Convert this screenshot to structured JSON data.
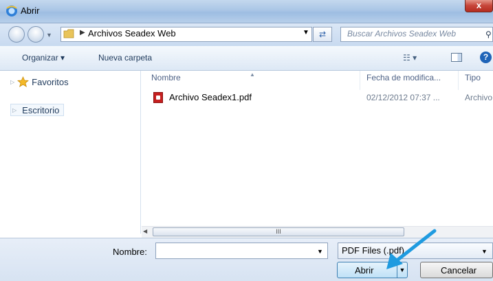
{
  "window": {
    "title": "Abrir",
    "close_label": "x"
  },
  "address": {
    "path": "Archivos Seadex Web",
    "search_placeholder": "Buscar Archivos Seadex Web",
    "refresh_glyph": "⇄"
  },
  "toolbar": {
    "organize_label": "Organizar ▾",
    "new_folder_label": "Nueva carpeta",
    "views_label": "☷ ▾",
    "help_label": "?"
  },
  "sidebar": {
    "items": [
      {
        "label": "Favoritos",
        "icon": "star-icon"
      },
      {
        "label": "Escritorio",
        "icon": "desktop-icon"
      }
    ]
  },
  "file_list": {
    "columns": [
      "Nombre",
      "Fecha de modifica...",
      "Tipo"
    ],
    "rows": [
      {
        "name": "Archivo Seadex1.pdf",
        "date": "02/12/2012 07:37 ...",
        "type": "Archivo"
      }
    ],
    "scroll_thumb_grip": "III"
  },
  "footer": {
    "filename_label": "Nombre:",
    "filename_value": "",
    "filter_value": "PDF Files (.pdf)",
    "open_label": "Abrir",
    "cancel_label": "Cancelar"
  },
  "colors": {
    "accent": "#1f9be0",
    "close": "#c7463a",
    "pdf": "#c61f1f"
  }
}
